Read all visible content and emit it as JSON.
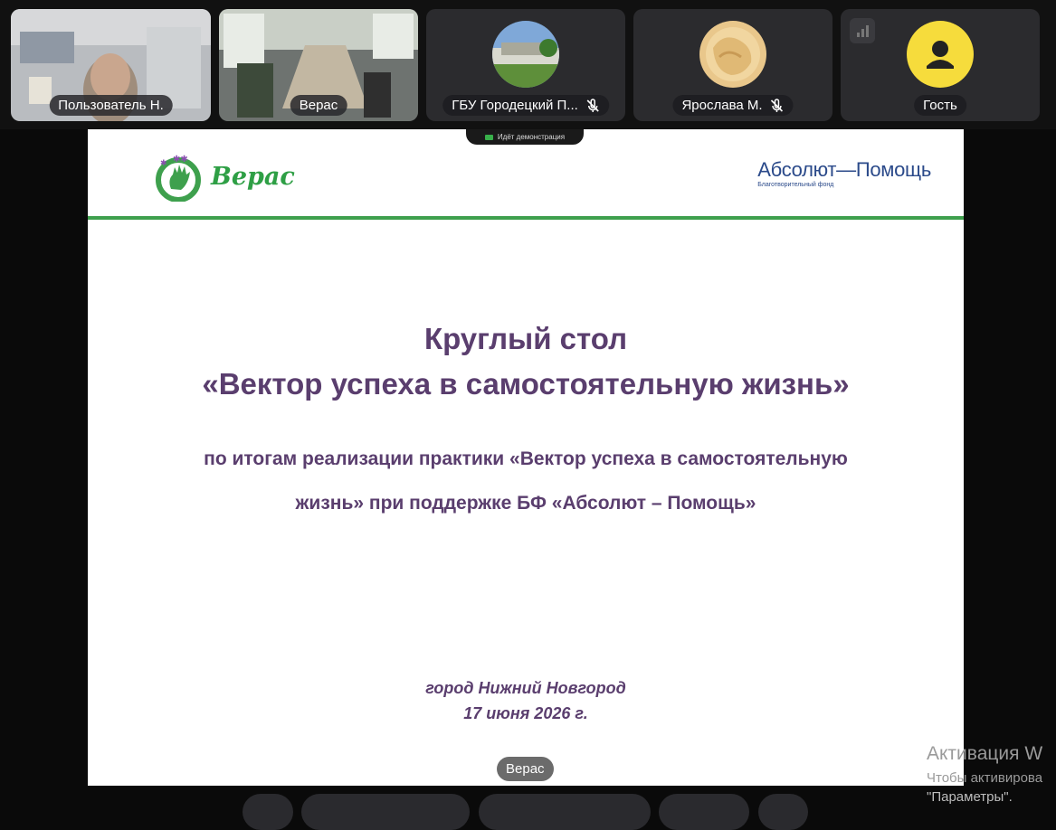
{
  "participants": [
    {
      "name": "Пользователь Н.",
      "muted": false
    },
    {
      "name": "Верас",
      "muted": false
    },
    {
      "name": "ГБУ Городецкий П...",
      "muted": true
    },
    {
      "name": "Ярослава М.",
      "muted": true
    },
    {
      "name": "Гость",
      "muted": false
    }
  ],
  "demo_label": "Идёт демонстрация",
  "slide": {
    "logo_left": "Верас",
    "logo_right_main": "Абсолют—Помощь",
    "logo_right_sub": "Благотворительный фонд",
    "title_line1": "Круглый стол",
    "title_line2": "«Вектор успеха в самостоятельную жизнь»",
    "subtitle_line1": "по итогам реализации практики «Вектор успеха в самостоятельную",
    "subtitle_line2": "жизнь» при поддержке БФ «Абсолют – Помощь»",
    "city": "город Нижний Новгород",
    "date": "17 июня 2026  г."
  },
  "speaker_badge": "Верас",
  "activation": {
    "line1": "Активация W",
    "line2": "Чтобы активирова",
    "line3": "\"Параметры\"."
  },
  "colors": {
    "accent_green": "#3ea04d",
    "title_purple": "#5a3e6e",
    "guest_avatar": "#f6dc3c"
  }
}
